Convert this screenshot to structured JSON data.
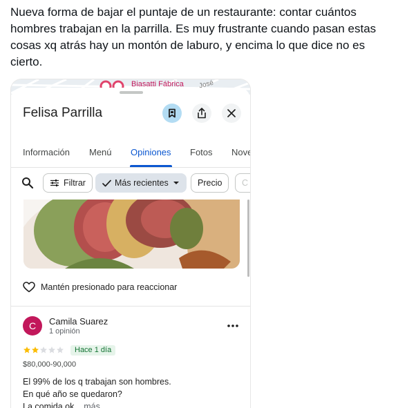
{
  "post": {
    "lines": [
      "Nueva forma de bajar el puntaje de un restaurante: contar cuántos",
      "hombres trabajan en la parrilla. Es muy frustrante cuando pasan estas",
      "cosas xq atrás hay un montón de laburo, y encima lo que dice no es",
      "cierto."
    ]
  },
  "map": {
    "poi_label": "Biasatti Fábrica",
    "street_label": "José"
  },
  "place": {
    "name": "Felisa Parrilla"
  },
  "tabs": [
    {
      "label": "Información",
      "active": false
    },
    {
      "label": "Menú",
      "active": false
    },
    {
      "label": "Opiniones",
      "active": true
    },
    {
      "label": "Fotos",
      "active": false
    },
    {
      "label": "Nove",
      "active": false
    }
  ],
  "chips": {
    "filter": "Filtrar",
    "recent": "Más recientes",
    "price": "Precio",
    "more": "C"
  },
  "react_label": "Mantén presionado para reaccionar",
  "review": {
    "avatar_letter": "C",
    "avatar_color": "#c2185b",
    "author": "Camila Suarez",
    "author_sub": "1 opinión",
    "rating": 2,
    "max_rating": 5,
    "time_badge": "Hace 1 día",
    "price_range": "$80,000-90,000",
    "text_lines": [
      "El 99% de los q trabajan son hombres.",
      "En qué año se quedaron?",
      "La comida ok..."
    ],
    "more_link": "más"
  },
  "colors": {
    "accent_blue": "#0b57d0",
    "star_filled": "#fbbc04",
    "star_empty": "#dadce0",
    "badge_bg": "#e6f4ea",
    "badge_text": "#137333"
  }
}
